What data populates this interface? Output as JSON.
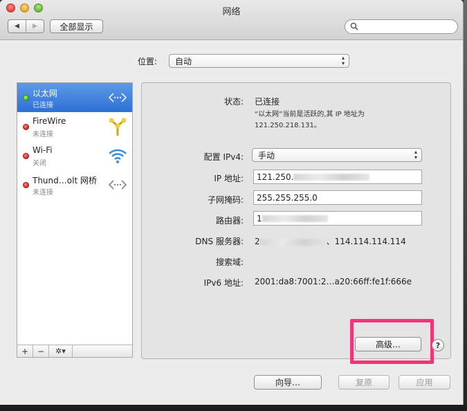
{
  "window": {
    "title": "网络"
  },
  "toolbar": {
    "back_label": "◀",
    "forward_label": "▶",
    "show_all_label": "全部显示",
    "search_placeholder": ""
  },
  "location": {
    "label": "位置:",
    "value": "自动"
  },
  "services": [
    {
      "name": "以太网",
      "status": "已连接",
      "state": "green",
      "icon": "ethernet-icon",
      "selected": true
    },
    {
      "name": "FireWire",
      "status": "未连接",
      "state": "red",
      "icon": "firewire-icon",
      "selected": false
    },
    {
      "name": "Wi-Fi",
      "status": "关闭",
      "state": "red",
      "icon": "wifi-icon",
      "selected": false
    },
    {
      "name": "Thund…olt 网桥",
      "status": "未连接",
      "state": "red",
      "icon": "thunderbolt-bridge-icon",
      "selected": false
    }
  ],
  "sidebar_buttons": {
    "add": "+",
    "remove": "−",
    "gear": "✲▾"
  },
  "details": {
    "status_label": "状态:",
    "status_value": "已连接",
    "status_note_line1": "“以太网”当前是活跃的,其 IP 地址为",
    "status_note_line2": "121.250.218.131。",
    "config_label": "配置 IPv4:",
    "config_value": "手动",
    "ip_label": "IP 地址:",
    "ip_value": "121.250.",
    "subnet_label": "子网掩码:",
    "subnet_value": "255.255.255.0",
    "router_label": "路由器:",
    "router_value": "1",
    "dns_label": "DNS 服务器:",
    "dns_prefix": "2",
    "dns_value": "、114.114.114.114",
    "search_domain_label": "搜索域:",
    "ipv6_label": "IPv6 地址:",
    "ipv6_value": "2001:da8:7001:2…a20:66ff:fe1f:666e"
  },
  "buttons": {
    "advanced": "高级…",
    "help": "?",
    "assist": "向导…",
    "revert": "复原",
    "apply": "应用"
  },
  "colors": {
    "highlight": "#f0357b",
    "selection": "#2e6fd6"
  }
}
